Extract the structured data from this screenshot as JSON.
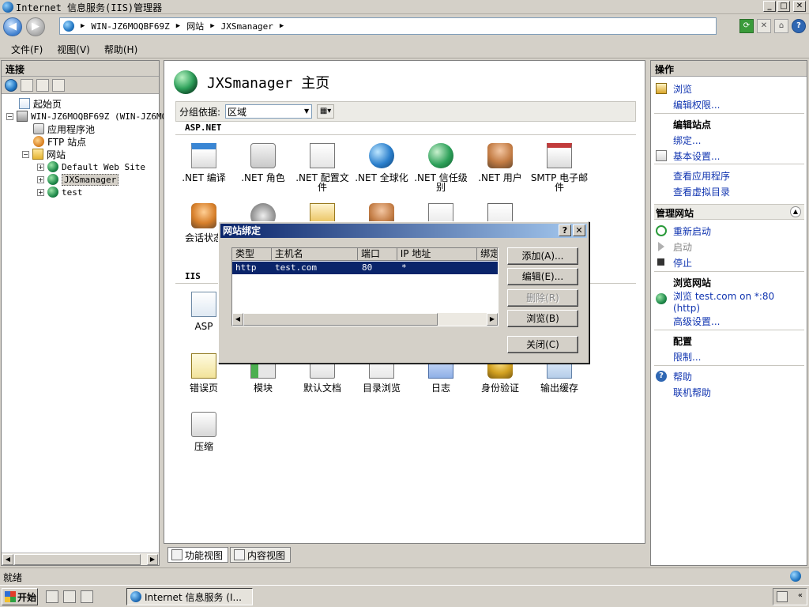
{
  "window": {
    "title": "Internet 信息服务(IIS)管理器"
  },
  "address": {
    "crumbs": [
      "WIN-JZ6MOQBF69Z",
      "网站",
      "JXSmanager"
    ]
  },
  "menu": [
    "文件(F)",
    "视图(V)",
    "帮助(H)"
  ],
  "connections": {
    "header": "连接",
    "tree": {
      "start_page": "起始页",
      "server": "WIN-JZ6MOQBF69Z (WIN-JZ6MO",
      "app_pools": "应用程序池",
      "ftp_sites": "FTP 站点",
      "sites": "网站",
      "site1": "Default Web Site",
      "site2": "JXSmanager",
      "site3": "test"
    }
  },
  "center": {
    "title": "JXSmanager 主页",
    "group_by_label": "分组依据:",
    "group_by_value": "区域",
    "section_aspnet": "ASP.NET",
    "section_iis": "IIS",
    "features": {
      "net_compile": ".NET 编译",
      "net_roles": ".NET 角色",
      "net_profile": ".NET 配置文件",
      "net_global": ".NET 全球化",
      "net_trust": ".NET 信任级别",
      "net_users": ".NET 用户",
      "smtp": "SMTP 电子邮件",
      "session": "会话状态",
      "asp": "ASP",
      "errors": "错误页",
      "modules": "模块",
      "default_doc": "默认文档",
      "dir_browse": "目录浏览",
      "logging": "日志",
      "auth": "身份验证",
      "output_cache": "输出缓存",
      "compression": "压缩"
    }
  },
  "bottom_tabs": {
    "features_view": "功能视图",
    "content_view": "内容视图"
  },
  "actions": {
    "header": "操作",
    "browse": "浏览",
    "edit_perms": "编辑权限...",
    "edit_site": "编辑站点",
    "bindings": "绑定...",
    "basic_settings": "基本设置...",
    "view_apps": "查看应用程序",
    "view_vdirs": "查看虚拟目录",
    "manage_site": "管理网站",
    "restart": "重新启动",
    "start": "启动",
    "stop": "停止",
    "browse_site": "浏览网站",
    "browse_binding_line1": "浏览 test.com on *:80",
    "browse_binding_line2": "(http)",
    "advanced": "高级设置...",
    "config": "配置",
    "limits": "限制...",
    "help": "帮助",
    "online_help": "联机帮助"
  },
  "status": {
    "text": "就绪"
  },
  "taskbar": {
    "start": "开始",
    "task": "Internet 信息服务 (I..."
  },
  "dialog": {
    "title": "网站绑定",
    "columns": [
      "类型",
      "主机名",
      "端口",
      "IP 地址",
      "绑定"
    ],
    "rows": [
      {
        "type": "http",
        "host": "test.com",
        "port": "80",
        "ip": "*",
        "binding": ""
      }
    ],
    "buttons": {
      "add": "添加(A)...",
      "edit": "编辑(E)...",
      "remove": "删除(R)",
      "browse": "浏览(B)",
      "close": "关闭(C)"
    }
  }
}
